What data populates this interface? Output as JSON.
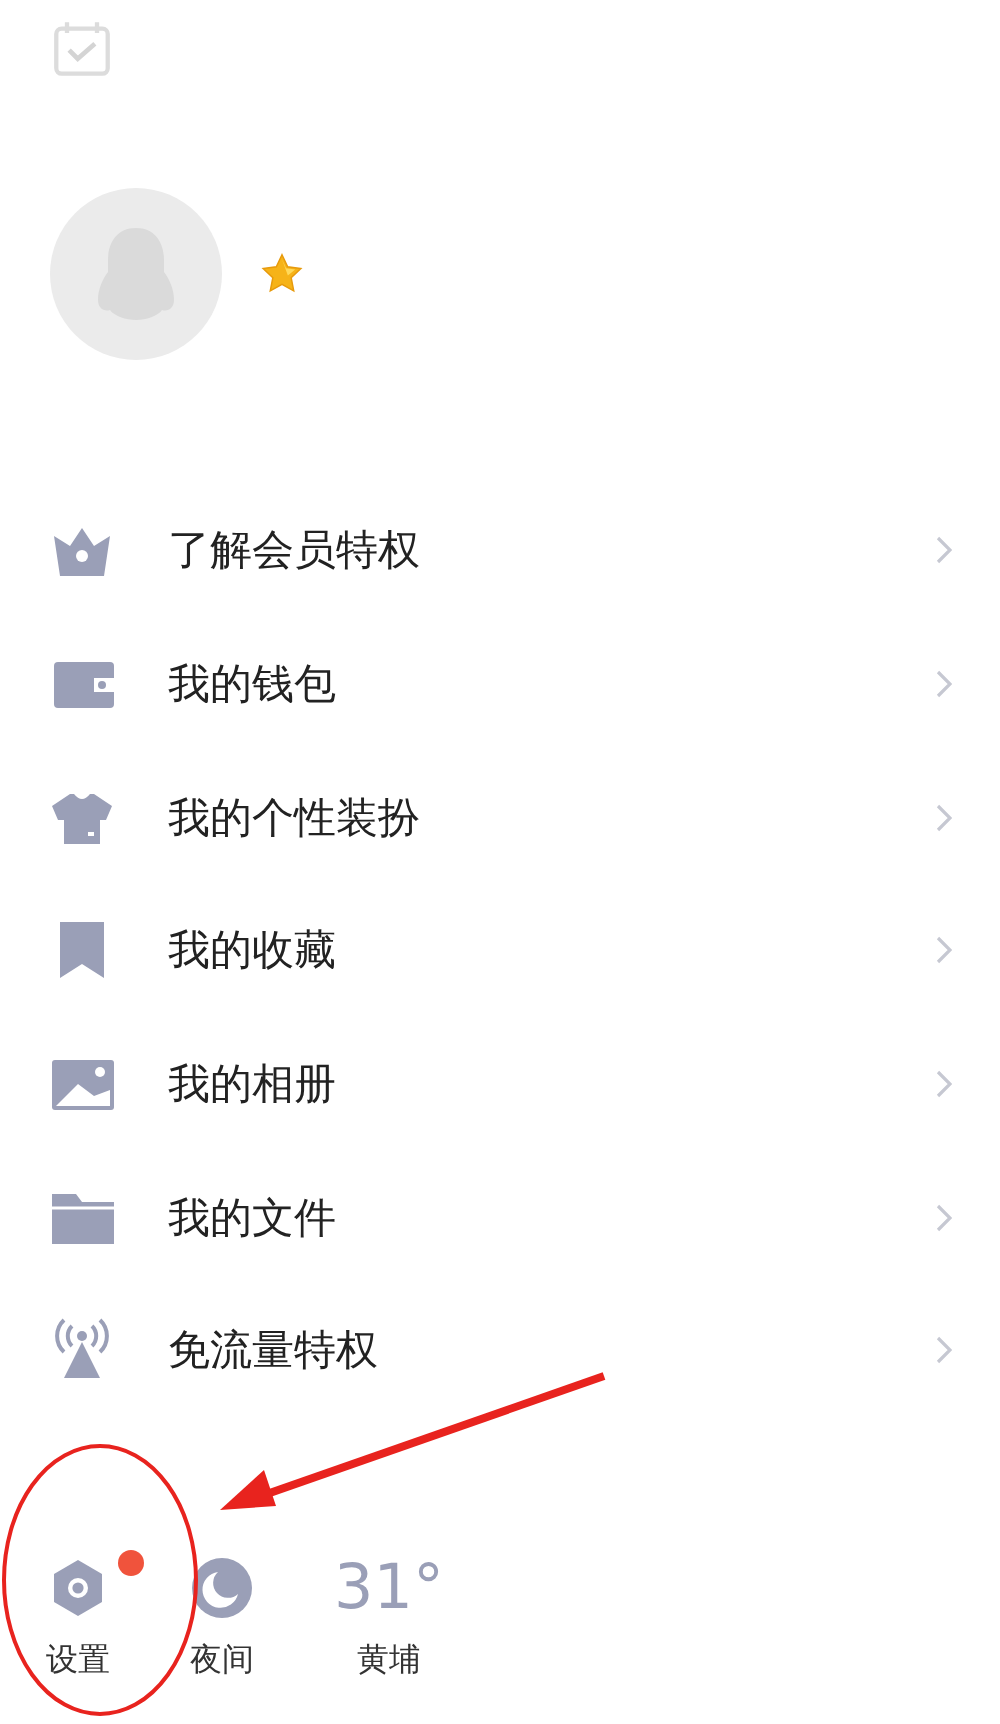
{
  "header": {
    "kind": "checkin"
  },
  "profile": {
    "vip_star": true
  },
  "menu": [
    {
      "kind": "crown",
      "label": "了解会员特权"
    },
    {
      "kind": "wallet",
      "label": "我的钱包"
    },
    {
      "kind": "shirt",
      "label": "我的个性装扮"
    },
    {
      "kind": "bookmark",
      "label": "我的收藏"
    },
    {
      "kind": "image",
      "label": "我的相册"
    },
    {
      "kind": "folder",
      "label": "我的文件"
    },
    {
      "kind": "signal",
      "label": "免流量特权"
    }
  ],
  "bottom_bar": [
    {
      "kind": "settings",
      "label": "设置",
      "badge": true
    },
    {
      "kind": "night",
      "label": "夜间",
      "badge": false
    },
    {
      "kind": "weather",
      "temperature": "31°",
      "label": "黄埔"
    }
  ]
}
